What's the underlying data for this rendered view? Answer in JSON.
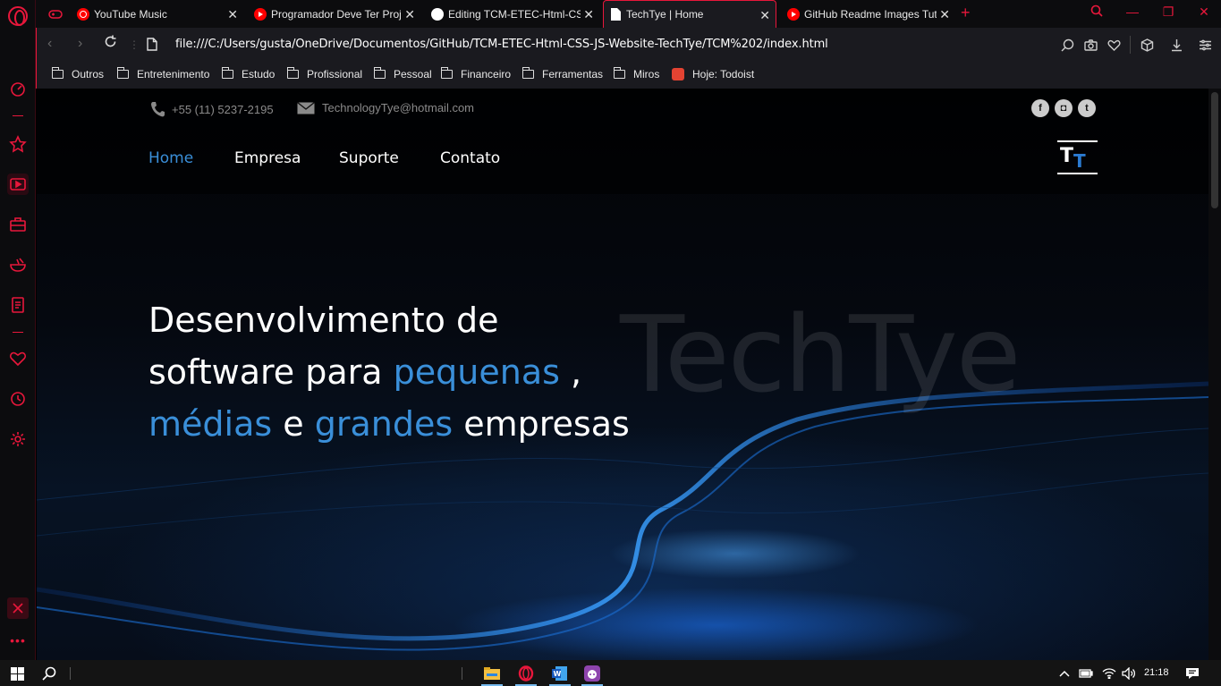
{
  "browser": {
    "tabs": [
      {
        "title": "YouTube Music",
        "icon": "youtube-music-icon"
      },
      {
        "title": "Programador Deve Ter Proj",
        "icon": "youtube-icon"
      },
      {
        "title": "Editing TCM-ETEC-Html-CS",
        "icon": "github-icon"
      },
      {
        "title": "TechTye | Home",
        "icon": "document-icon",
        "active": true
      },
      {
        "title": "GitHub Readme Images Tut",
        "icon": "youtube-icon"
      }
    ],
    "url": "file:///C:/Users/gusta/OneDrive/Documentos/GitHub/TCM-ETEC-Html-CSS-JS-Website-TechTye/TCM%202/index.html",
    "bookmarks": [
      "Outros",
      "Entretenimento",
      "Estudo",
      "Profissional",
      "Pessoal",
      "Financeiro",
      "Ferramentas",
      "Miros",
      "Hoje: Todoist"
    ],
    "accent": "#e8173b"
  },
  "site": {
    "phone": "+55 (11) 5237-2195",
    "email": "TechnologyTye@hotmail.com",
    "social": [
      "facebook-icon",
      "instagram-icon",
      "twitter-icon"
    ],
    "nav": [
      "Home",
      "Empresa",
      "Suporte",
      "Contato"
    ],
    "logo": {
      "t1": "T",
      "t2": "T"
    },
    "watermark": "TechTye",
    "headline": {
      "l1": "Desenvolvimento de",
      "l2a": "software para ",
      "l2b": "pequenas",
      "l2c": " ,",
      "l3a": "médias",
      "l3b": " e ",
      "l3c": "grandes",
      "l3d": " empresas"
    },
    "highlight_color": "#3a8fd9"
  },
  "taskbar": {
    "time": "21:18"
  }
}
